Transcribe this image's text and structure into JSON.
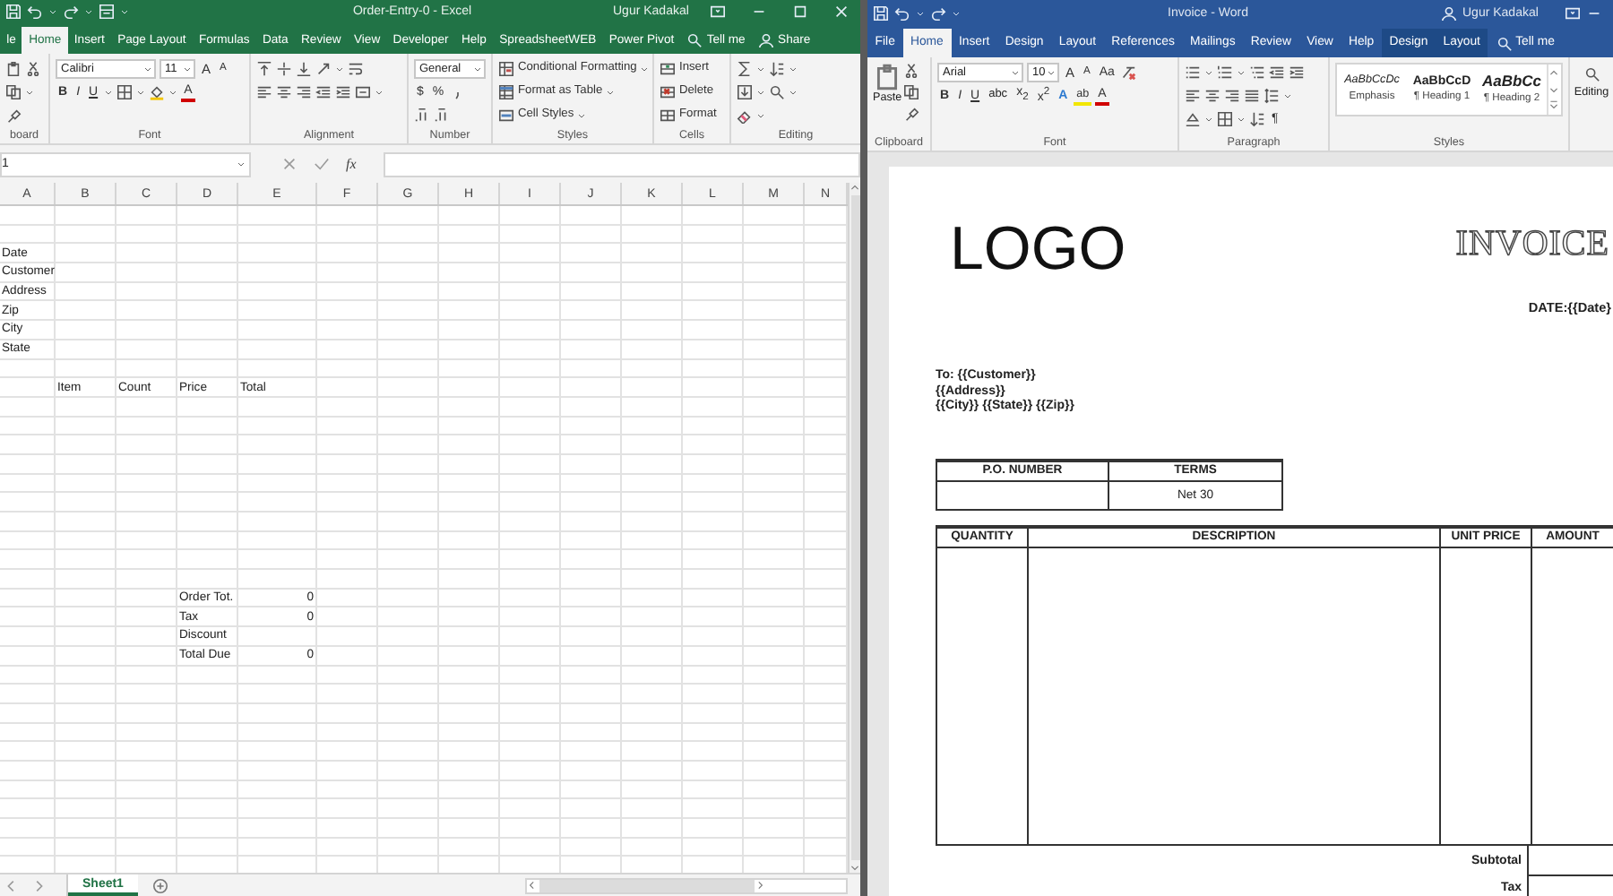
{
  "excel": {
    "title": "Order-Entry-0  -  Excel",
    "user": "Ugur Kadakal",
    "tabs": [
      {
        "label": "le",
        "selected": false
      },
      {
        "label": "Home",
        "selected": true
      },
      {
        "label": "Insert",
        "selected": false
      },
      {
        "label": "Page Layout",
        "selected": false
      },
      {
        "label": "Formulas",
        "selected": false
      },
      {
        "label": "Data",
        "selected": false
      },
      {
        "label": "Review",
        "selected": false
      },
      {
        "label": "View",
        "selected": false
      },
      {
        "label": "Developer",
        "selected": false
      },
      {
        "label": "Help",
        "selected": false
      },
      {
        "label": "SpreadsheetWEB",
        "selected": false
      },
      {
        "label": "Power Pivot",
        "selected": false
      }
    ],
    "tell_me": "Tell me",
    "share": "Share",
    "ribbon": {
      "groups": [
        "board",
        "Font",
        "Alignment",
        "Number",
        "Styles",
        "Cells",
        "Editing"
      ],
      "font_name": "Calibri",
      "font_size": "11",
      "size_buttons": [
        "A",
        "A"
      ],
      "format_buttons": [
        "B",
        "I",
        "U"
      ],
      "font_color": "A",
      "number_format": "General",
      "number_buttons": [
        "$",
        "%"
      ],
      "styles": [
        "Conditional Formatting",
        "Format as Table",
        "Cell Styles"
      ],
      "cells": [
        "Insert",
        "Delete",
        "Format"
      ]
    },
    "formula_bar": {
      "name_box": "1",
      "function_label": "fx"
    },
    "columns": [
      "A",
      "B",
      "C",
      "D",
      "E",
      "F",
      "G",
      "H",
      "I",
      "J",
      "K",
      "L",
      "M",
      "N"
    ],
    "rows": [
      {},
      {},
      {
        "A": {
          "text": "Date"
        }
      },
      {
        "A": {
          "text": "Customer"
        }
      },
      {
        "A": {
          "text": "Address"
        }
      },
      {
        "A": {
          "text": "Zip"
        }
      },
      {
        "A": {
          "text": "City"
        }
      },
      {
        "A": {
          "text": "State"
        }
      },
      {},
      {
        "B": {
          "text": "Item"
        },
        "C": {
          "text": "Count"
        },
        "D": {
          "text": "Price"
        },
        "E": {
          "text": "Total"
        }
      },
      {},
      {},
      {},
      {},
      {},
      {},
      {},
      {},
      {},
      {},
      {
        "D": {
          "text": "Order Tot."
        },
        "E": {
          "text": "0",
          "numeric": true
        }
      },
      {
        "D": {
          "text": "Tax"
        },
        "E": {
          "text": "0",
          "numeric": true
        }
      },
      {
        "D": {
          "text": "Discount"
        }
      },
      {
        "D": {
          "text": "Total Due"
        },
        "E": {
          "text": "0",
          "numeric": true
        }
      }
    ],
    "sheet_tabs": [
      {
        "label": "Sheet1",
        "selected": true
      }
    ]
  },
  "word": {
    "title": "Invoice  -  Word",
    "user": "Ugur Kadakal",
    "tabs": [
      {
        "label": "File",
        "selected": false,
        "contextual": false
      },
      {
        "label": "Home",
        "selected": true,
        "contextual": false
      },
      {
        "label": "Insert",
        "selected": false,
        "contextual": false
      },
      {
        "label": "Design",
        "selected": false,
        "contextual": false
      },
      {
        "label": "Layout",
        "selected": false,
        "contextual": false
      },
      {
        "label": "References",
        "selected": false,
        "contextual": false
      },
      {
        "label": "Mailings",
        "selected": false,
        "contextual": false
      },
      {
        "label": "Review",
        "selected": false,
        "contextual": false
      },
      {
        "label": "View",
        "selected": false,
        "contextual": false
      },
      {
        "label": "Help",
        "selected": false,
        "contextual": false
      },
      {
        "label": "Design",
        "selected": false,
        "contextual": true
      },
      {
        "label": "Layout",
        "selected": false,
        "contextual": true
      }
    ],
    "tell_me": "Tell me",
    "ribbon": {
      "groups": [
        "Clipboard",
        "Font",
        "Paragraph",
        "Styles"
      ],
      "paste": "Paste",
      "font_name": "Arial",
      "font_size": "10",
      "size_buttons": [
        "A",
        "A"
      ],
      "change_case": "Aa",
      "format_buttons": [
        "B",
        "I",
        "U",
        "abc",
        "x$_{2}$",
        "x$^{2}$"
      ],
      "effects": "A",
      "highlight": "ab",
      "font_color": "A",
      "pilcrow": "¶",
      "styles": [
        {
          "sample": "AaBbCcDc",
          "name": "Emphasis",
          "kind": "emphasis"
        },
        {
          "sample": "AaBbCcD",
          "name": "¶ Heading 1",
          "kind": "heading1"
        },
        {
          "sample": "AaBbCc",
          "name": "¶ Heading 2",
          "kind": "heading2"
        }
      ],
      "editing": "Editing"
    },
    "document": {
      "logo": "LOGO",
      "title": "INVOICE",
      "date": "DATE:{{Date}",
      "address": [
        "To: {{Customer}}",
        "{{Address}}",
        "{{City}} {{State}} {{Zip}}"
      ],
      "po_table": {
        "headers": [
          "P.O. NUMBER",
          "TERMS"
        ],
        "terms": "Net 30"
      },
      "items_table": {
        "headers": [
          "QUANTITY",
          "DESCRIPTION",
          "UNIT PRICE",
          "AMOUNT"
        ]
      },
      "totals": [
        "Subtotal",
        "Tax"
      ]
    }
  }
}
